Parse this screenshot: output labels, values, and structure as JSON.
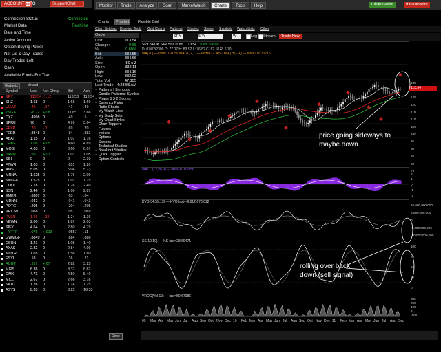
{
  "left": {
    "tabs": [
      "ACCOUNT INFO",
      "SupportChat"
    ],
    "account_rows": [
      {
        "label": "Connection Status",
        "value": "Connected"
      },
      {
        "label": "Market Data",
        "value": "Realtime"
      },
      {
        "label": "Date and Time",
        "value": ""
      },
      {
        "label": "Active Account",
        "value": ""
      },
      {
        "label": "Option Buying Power",
        "value": ""
      },
      {
        "label": "Net Liq & Day Trades",
        "value": ""
      },
      {
        "label": "Day Trades Left",
        "value": ""
      },
      {
        "label": "Cash",
        "value": ""
      },
      {
        "label": "Available Funds For Trad",
        "value": ""
      }
    ],
    "watchlist_controls": [
      "Gadgets",
      "default"
    ],
    "columns": [
      "Symbol",
      "Last",
      "Net Chng",
      "Bid",
      "Ask"
    ],
    "rows": [
      {
        "s": "SPY",
        "l": "113.54",
        "c": "-1.12",
        "b": "113.53",
        "a": "113.54",
        "col": "#ff3b3b"
      },
      {
        "s": "SHZ",
        "l": "1.68",
        "c": "0",
        "b": "1.68",
        "a": "1.69",
        "col": "#ffffff"
      },
      {
        "s": "UGAZ",
        "l": ".49",
        "c": "-.07",
        "b": ".41",
        "a": ".49",
        "col": "#ff3b3b"
      },
      {
        "s": "ZNGA",
        "l": "26.22",
        "c": "+.08",
        "b": "11.65",
        "a": "3.66",
        "col": "#2ecc40"
      },
      {
        "s": "CXZ",
        "l": ".4998",
        "c": "0",
        "b": ".49",
        "a": ".5",
        "col": "#ffffff"
      },
      {
        "s": "SPRE",
        "l": "76",
        "c": "0",
        "b": "4.99",
        "a": "5.04",
        "col": "#ffffff"
      },
      {
        "s": "EFYR",
        "l": ".70",
        "c": "-.01",
        "b": ".69",
        "a": ".70",
        "col": "#ff3b3b"
      },
      {
        "s": "FEED",
        "l": ".8848",
        "c": "0",
        "b": ".84",
        "a": ".883",
        "col": "#ffffff"
      },
      {
        "s": "ABAT",
        "l": "1.15",
        "c": "0",
        "b": "1.07",
        "a": "1.16",
        "col": "#ffffff"
      },
      {
        "s": "LEXG",
        "l": "1.08",
        "c": "+.05",
        "b": "4.60",
        "a": "4.89",
        "col": "#2ecc40"
      },
      {
        "s": "MOBI",
        "l": "4.03",
        "c": "0",
        "b": "3.60",
        "a": "6.07",
        "col": "#ffffff"
      },
      {
        "s": "JAMN",
        "l": ".58",
        "c": "+.07",
        "b": "1.01",
        "a": "1.05",
        "col": "#2ecc40"
      },
      {
        "s": "SIH",
        "l": "0",
        "c": "0",
        "b": "0",
        "a": "2.30",
        "col": "#ffffff"
      },
      {
        "s": "FTWR",
        "l": "1.03",
        "c": "0",
        "b": ".851",
        "a": "1.20",
        "col": "#ffffff"
      },
      {
        "s": "AMSC",
        "l": "5.05",
        "c": "0",
        "b": "5.04",
        "a": "5.73",
        "col": "#ffffff"
      },
      {
        "s": "MRNA",
        "l": "1.625",
        "c": "0",
        "b": "1.76",
        "a": "2.00",
        "col": "#ffffff"
      },
      {
        "s": "SNOFF",
        "l": "1.575",
        "c": "0",
        "b": "1.03",
        "a": "1.75",
        "col": "#ffffff"
      },
      {
        "s": "COOL",
        "l": "2.18",
        "c": "0",
        "b": "1.76",
        "a": "2.40",
        "col": "#ffffff"
      },
      {
        "s": "SSN",
        "l": "2.46",
        "c": "0",
        "b": "1.00",
        "a": "2.87",
        "col": "#ffffff"
      },
      {
        "s": "EMKR",
        "l": ".6307",
        "c": "0",
        "b": ".63",
        "a": ".64",
        "col": "#ffffff"
      },
      {
        "s": "MDNN",
        "l": ".042",
        "c": "0",
        "b": ".041",
        "a": ".042",
        "col": "#ffffff"
      },
      {
        "s": "POTG",
        "l": ".205",
        "c": "0",
        "b": ".204",
        "a": ".205",
        "col": "#ffffff"
      },
      {
        "s": "VRIOW",
        "l": ".068",
        "c": "0",
        "b": ".05",
        "a": ".069",
        "col": "#ffffff"
      },
      {
        "s": "RVLN",
        "l": "1.26",
        "c": "-.03",
        "b": "1.24",
        "a": "1.36",
        "col": "#ff3b3b"
      },
      {
        "s": "NEWN",
        "l": "2.00",
        "c": "0",
        "b": "1.87",
        "a": "2.03",
        "col": "#ffffff"
      },
      {
        "s": "SIFY",
        "l": "4.64",
        "c": "0",
        "b": "2.80",
        "a": "4.79",
        "col": "#ffffff"
      },
      {
        "s": "HYTTF",
        "l": ".078",
        "c": "+.013",
        "b": ".0557",
        "a": ".11",
        "col": "#2ecc40"
      },
      {
        "s": "GWMGF",
        "l": ".8849",
        "c": "0",
        "b": ".884",
        "a": ".886",
        "col": "#ffffff"
      },
      {
        "s": "CSUN",
        "l": "1.21",
        "c": "0",
        "b": "1.08",
        "a": "1.40",
        "col": "#ffffff"
      },
      {
        "s": "AXAS",
        "l": "2.82",
        "c": "0",
        "b": "2.84",
        "a": "4.00",
        "col": "#ffffff"
      },
      {
        "s": "MOTR",
        "l": "1.65",
        "c": "0",
        "b": "1.56",
        "a": "1.80",
        "col": "#ffffff"
      },
      {
        "s": "ESYL",
        "l": ".18",
        "c": "0",
        "b": ".16",
        "a": ".21",
        "col": "#ffffff"
      },
      {
        "s": "AUGT",
        "l": ".317",
        "c": "+.07",
        "b": "2.82",
        "a": "3.25",
        "col": "#2ecc40"
      },
      {
        "s": "MIPS",
        "l": "8.38",
        "c": "0",
        "b": "8.37",
        "a": "8.62",
        "col": "#ffffff"
      },
      {
        "s": "OMX",
        "l": "4.73",
        "c": "0",
        "b": "4.50",
        "a": "5.40",
        "col": "#ffffff"
      },
      {
        "s": "MILL",
        "l": "2.67",
        "c": "0",
        "b": "2.66",
        "a": "3.16",
        "col": "#ffffff"
      },
      {
        "s": "SATC",
        "l": "1.26",
        "c": "0",
        "b": "1.24",
        "a": "1.25",
        "col": "#ffffff"
      },
      {
        "s": "ASYS",
        "l": "8.33",
        "c": "0",
        "b": "8.25",
        "a": "16.33",
        "col": "#ffffff"
      }
    ],
    "done_label": "Done"
  },
  "nav": {
    "tabs": [
      "Monitor",
      "Trade",
      "Analyze",
      "Scan",
      "MarketWatch",
      "Charts",
      "Tools",
      "Help"
    ],
    "active_tab": "Charts",
    "brand": "thinkorswim",
    "logo": "thinkorswim",
    "subtabs": [
      "Charts",
      "Prophet",
      "Flexible Grid"
    ],
    "menu": [
      "Chart Settings",
      "Drawing Tools",
      "Grid Charts",
      "Patterns",
      "Studies",
      "Styles",
      "Symbols",
      "Watch Lists",
      "Other"
    ]
  },
  "quote": {
    "header": "Quote",
    "rows": [
      {
        "l": "Last:",
        "v": "113.54",
        "col": "#ffffff"
      },
      {
        "l": "Change:",
        "v": "0.68",
        "col": "#2ecc40"
      },
      {
        "l": "%:",
        "v": "0.60%",
        "col": "#2ecc40"
      },
      {
        "l": "Bid:",
        "v": "334.55",
        "col": "#ffffff"
      },
      {
        "l": "Ask:",
        "v": "334.66",
        "col": "#ffffff"
      },
      {
        "l": "Size:",
        "v": "50 x Z",
        "col": "#ffffff"
      },
      {
        "l": "Open:",
        "v": "332.11",
        "col": "#ffffff"
      },
      {
        "l": "High:",
        "v": "334.16",
        "col": "#ffffff"
      },
      {
        "l": "Low:",
        "v": "332.02",
        "col": "#ffffff"
      },
      {
        "l": "Total Vol:",
        "v": "47,155",
        "col": "#ffffff"
      },
      {
        "l": "Last Trade:",
        "v": "4:23:55 AM",
        "col": "#ffffff"
      }
    ],
    "menu": [
      "Patterns | Symbols",
      "Candle Patterns: Symbol",
      "Phase 1 3 2 Scores",
      "Currency Pairs",
      "Ratio Charts",
      "My Watch Lists",
      "My Study Sets",
      "My Chart Styles",
      "Chart Toppers",
      "Futures",
      "Indices",
      "Options",
      "Sectors",
      "Technical Studies",
      "Breakout Studies",
      "Quick Toggles",
      "Option Controls"
    ]
  },
  "chart": {
    "toolbar": {
      "symbol": "SPY",
      "period": "5 Yr",
      "interval": "W",
      "log": "Log",
      "stream": "Stream",
      "trade": "Trade Now"
    },
    "title": "SPY SPDR S&P 500 Trust",
    "title_last": "113.54",
    "title_chg": "0.68",
    "title_pct": "0.60%",
    "ohlc_line": "D: 07/02/2009  O: 77.07  H: 83.52  L: 76.82  C: 82.18  R: 6.70",
    "ma_line": "MA(20) — last=119.059    MA(20,2,... — last=122.905   DMA(20,-14) — last=110.31716",
    "price_axis": [
      "135",
      "130",
      "125",
      "120",
      "115",
      "110",
      "105",
      "100",
      "95",
      "90",
      "85",
      "80",
      "75"
    ],
    "current_price": "113.54",
    "osc_title": "MACD(12,26,9)  — last=-0.010356",
    "osc_axis": [
      "2",
      "1",
      "0",
      "-1",
      "-2"
    ],
    "kvo_title": "KVO(34,55,13) — KVO    last=-6,012,673.012",
    "kvo_axis": [
      "10,000,000,000",
      "5,000,000,000",
      "0",
      "-5,000,000,000",
      "-10,000,000,000"
    ],
    "ss_title": "SS(10,10) — %K    last=28.69471",
    "ss_axis": [
      "100",
      "75",
      "50",
      "25",
      "0"
    ],
    "vroc_title": "VROC(Vol,10)  — last=50.67086",
    "vroc_axis": [
      "300",
      "200",
      "100",
      "0",
      "-100"
    ],
    "months": [
      "09",
      "Mar",
      "Apr",
      "May",
      "Jun",
      "Jul",
      "Aug",
      "Sep",
      "Oct",
      "Nov",
      "Dec",
      "10",
      "Feb",
      "Mar",
      "Apr",
      "May",
      "Jun",
      "Jul",
      "Aug",
      "Sep",
      "Oct",
      "Nov",
      "Dec",
      "11",
      "Feb",
      "Mar",
      "Apr",
      "May",
      "Jun",
      "Jul",
      "Aug",
      "Sep"
    ],
    "annotation1": "price going sideways to\nmaybe down",
    "annotation2": "rolling over back\ndown (sell signal)"
  }
}
